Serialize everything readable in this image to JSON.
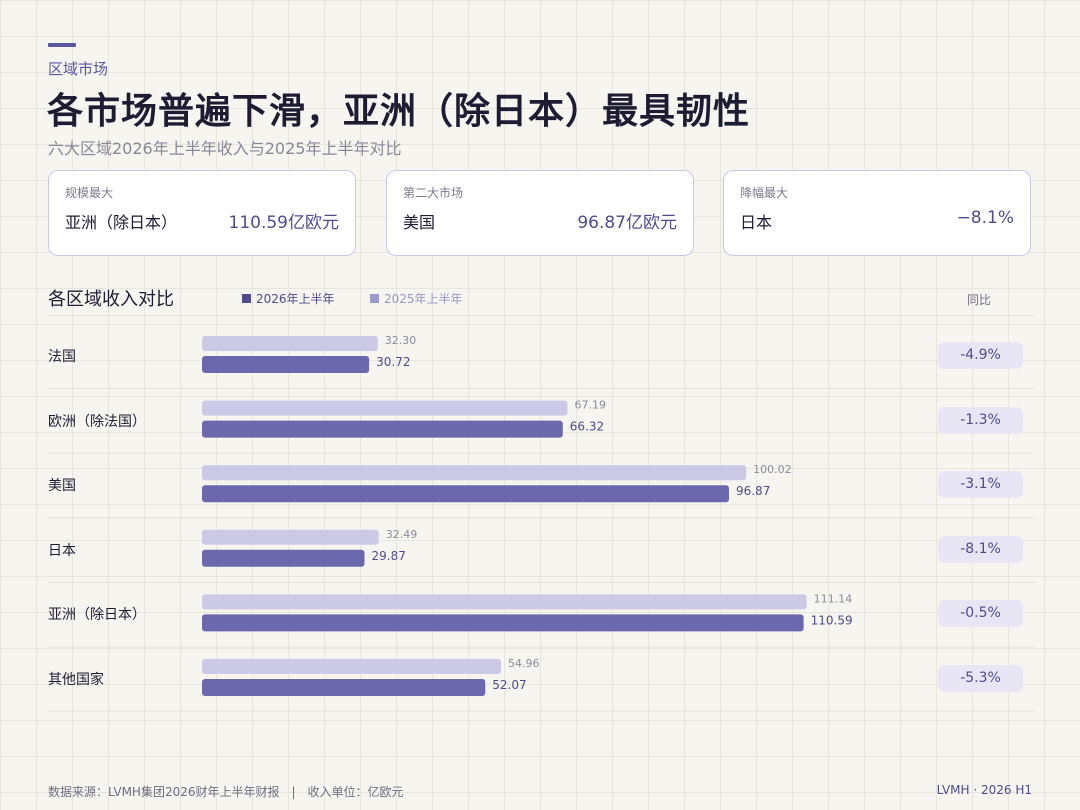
{
  "header": {
    "eyebrow": "区域市场",
    "title": "各市场普遍下滑，亚洲（除日本）最具韧性",
    "subtitle": "六大区域2026年上半年收入与2025年上半年对比"
  },
  "kpis": [
    {
      "label": "规模最大",
      "name": "亚洲（除日本）",
      "value": "110.59亿欧元"
    },
    {
      "label": "第二大市场",
      "name": "美国",
      "value": "96.87亿欧元"
    },
    {
      "label": "降幅最大",
      "name": "日本",
      "value": "−8.1%"
    }
  ],
  "section": {
    "title": "各区域收入对比",
    "legend_current": "2026年上半年",
    "legend_prior": "2025年上半年",
    "yoy_header": "同比"
  },
  "colors": {
    "current": "#6b68ae",
    "prior": "#cbc9e5",
    "accent": "#5a57a1",
    "pill_bg": "#e8e6f4"
  },
  "chart_data": {
    "type": "bar",
    "orientation": "horizontal",
    "title": "各区域收入对比",
    "categories": [
      "法国",
      "欧洲（除法国）",
      "美国",
      "日本",
      "亚洲（除日本）",
      "其他国家"
    ],
    "series": [
      {
        "name": "2025年上半年",
        "values": [
          32.3,
          67.19,
          100.02,
          32.49,
          111.14,
          54.96
        ],
        "labels": [
          "32.30",
          "67.19",
          "100.02",
          "32.49",
          "111.14",
          "54.96"
        ]
      },
      {
        "name": "2026年上半年",
        "values": [
          30.72,
          66.32,
          96.87,
          29.87,
          110.59,
          52.07
        ],
        "labels": [
          "30.72",
          "66.32",
          "96.87",
          "29.87",
          "110.59",
          "52.07"
        ]
      }
    ],
    "yoy": [
      "-4.9%",
      "-1.3%",
      "-3.1%",
      "-8.1%",
      "-0.5%",
      "-5.3%"
    ],
    "xlim": [
      0,
      120
    ],
    "unit": "亿欧元"
  },
  "footer": {
    "left": "数据来源：LVMH集团2026财年上半年财报　|　收入单位：亿欧元",
    "right": "LVMH ·  2026 H1"
  }
}
